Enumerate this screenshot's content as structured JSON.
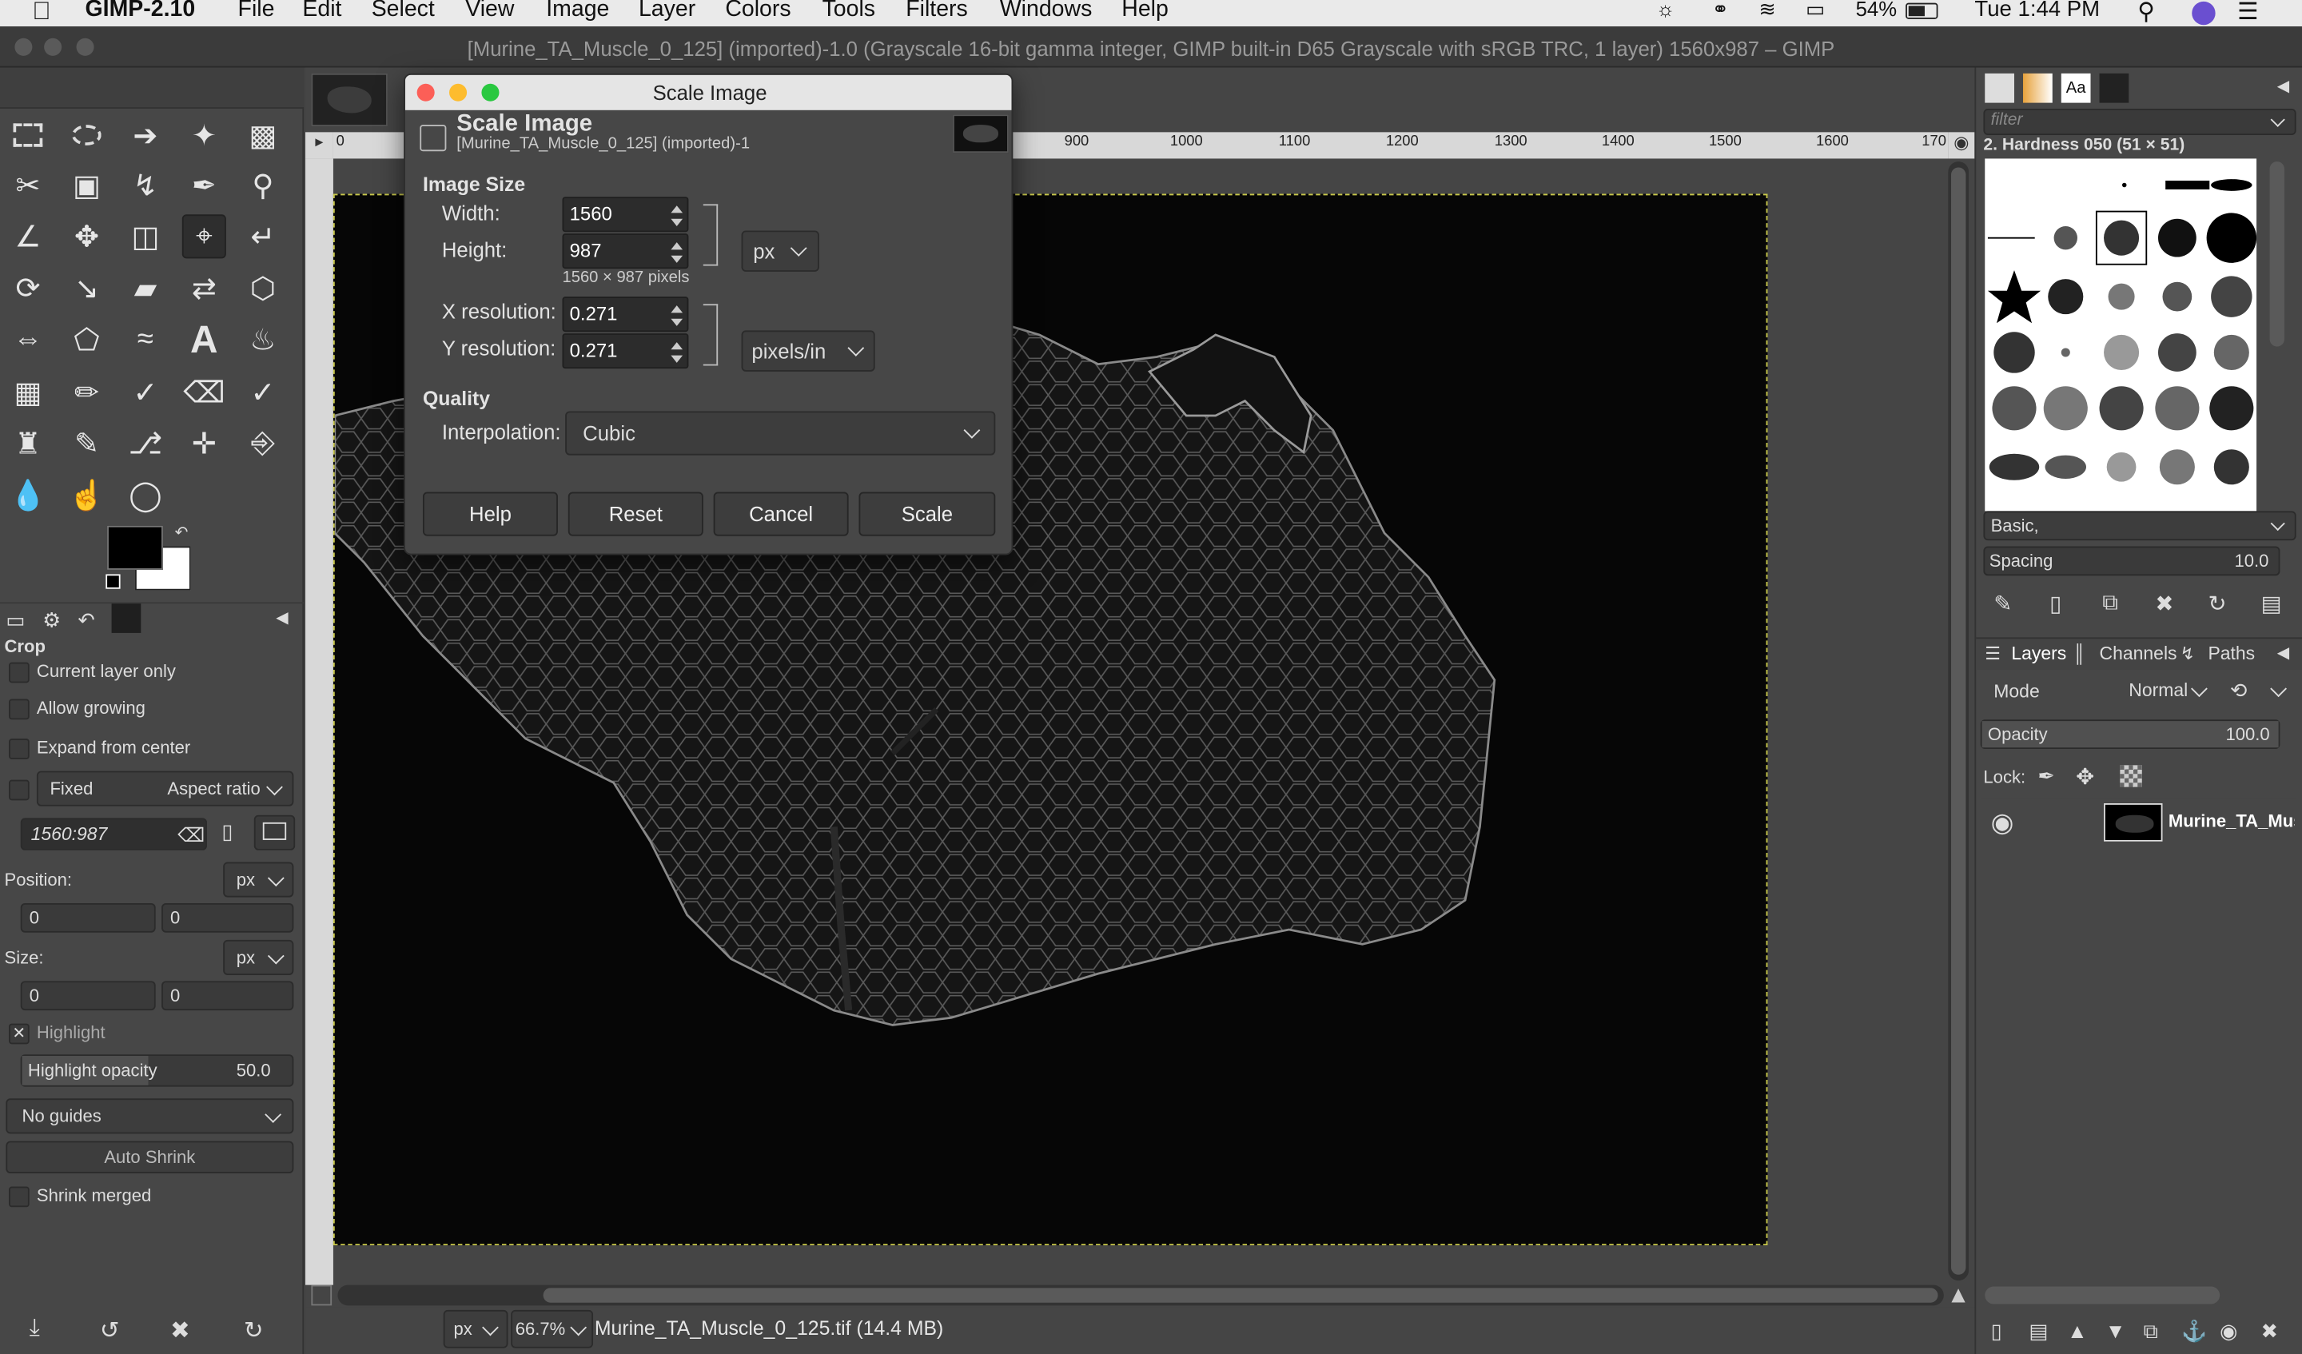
{
  "menubar": {
    "app": "GIMP-2.10",
    "items": [
      "File",
      "Edit",
      "Select",
      "View",
      "Image",
      "Layer",
      "Colors",
      "Tools",
      "Filters",
      "Windows",
      "Help"
    ],
    "battery": "54%",
    "clock": "Tue 1:44 PM"
  },
  "window": {
    "title": "[Murine_TA_Muscle_0_125] (imported)-1.0 (Grayscale 16-bit gamma integer, GIMP built-in D65 Grayscale with sRGB TRC, 1 layer) 1560x987 – GIMP"
  },
  "dialog": {
    "window_title": "Scale Image",
    "heading": "Scale Image",
    "subheading": "[Murine_TA_Muscle_0_125] (imported)-1",
    "image_size_label": "Image Size",
    "width_label": "Width:",
    "width_value": "1560",
    "height_label": "Height:",
    "height_value": "987",
    "size_unit": "px",
    "pixels_note": "1560 × 987 pixels",
    "xres_label": "X resolution:",
    "xres_value": "0.271",
    "yres_label": "Y resolution:",
    "yres_value": "0.271",
    "res_unit": "pixels/in",
    "quality_label": "Quality",
    "interp_label": "Interpolation:",
    "interp_value": "Cubic",
    "buttons": {
      "help": "Help",
      "reset": "Reset",
      "cancel": "Cancel",
      "scale": "Scale"
    }
  },
  "tool_options": {
    "title": "Crop",
    "current_layer_only": "Current layer only",
    "allow_growing": "Allow growing",
    "expand_from_center": "Expand from center",
    "fixed": "Fixed",
    "aspect_ratio": "Aspect ratio",
    "ratio_value": "1560:987",
    "position_label": "Position:",
    "position_unit": "px",
    "pos_x": "0",
    "pos_y": "0",
    "size_label": "Size:",
    "size_unit": "px",
    "size_w": "0",
    "size_h": "0",
    "highlight": "Highlight",
    "highlight_opacity_label": "Highlight opacity",
    "highlight_opacity_value": "50.0",
    "guides": "No guides",
    "auto_shrink": "Auto Shrink",
    "shrink_merged": "Shrink merged"
  },
  "ruler": {
    "top_ticks": [
      "0",
      "900",
      "1000",
      "1100",
      "1200",
      "1300",
      "1400",
      "1500",
      "1600",
      "170"
    ]
  },
  "brushes": {
    "filter_placeholder": "filter",
    "selected": "2. Hardness 050 (51 × 51)",
    "preset": "Basic,",
    "spacing_label": "Spacing",
    "spacing_value": "10.0"
  },
  "layers": {
    "tabs": [
      "Layers",
      "Channels",
      "Paths"
    ],
    "mode_label": "Mode",
    "mode_value": "Normal",
    "opacity_label": "Opacity",
    "opacity_value": "100.0",
    "lock_label": "Lock:",
    "layer_name": "Murine_TA_Musc"
  },
  "status": {
    "unit": "px",
    "zoom": "66.7%",
    "file": "Murine_TA_Muscle_0_125.tif (14.4 MB)"
  }
}
